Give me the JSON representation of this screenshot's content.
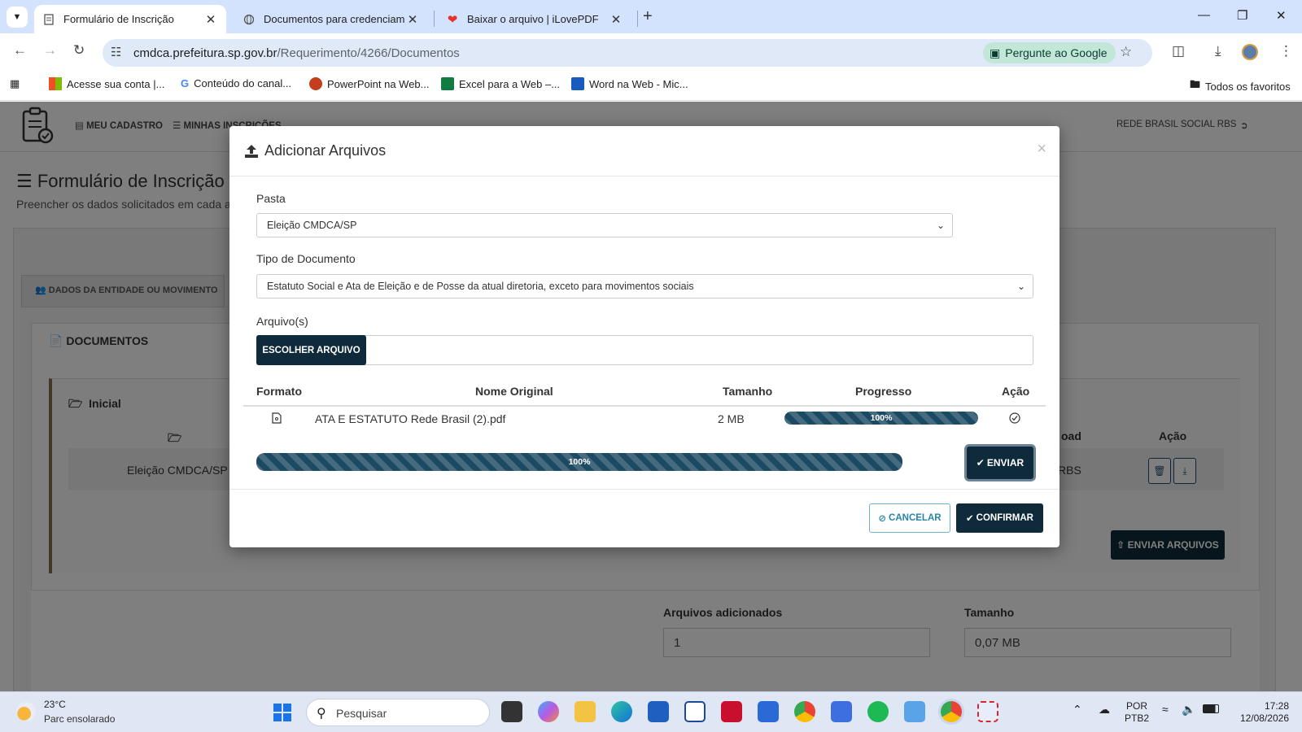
{
  "browser": {
    "tabs": [
      {
        "title": "Formulário de Inscrição",
        "active": true
      },
      {
        "title": "Documentos para credenciamento",
        "active": false
      },
      {
        "title": "Baixar o arquivo | iLovePDF",
        "active": false
      }
    ],
    "url_host": "cmdca.prefeitura.sp.gov.br",
    "url_path": "/Requerimento/4266/Documentos",
    "ask_google": "Pergunte ao Google",
    "bookmarks": [
      "Acesse sua conta |...",
      "Conteúdo do canal...",
      "PowerPoint na Web...",
      "Excel para a Web –...",
      "Word na Web - Mic..."
    ],
    "all_favorites": "Todos os favoritos"
  },
  "page": {
    "nav_cadastro": "MEU CADASTRO",
    "nav_inscricoes": "MINHAS INSCRIÇÕES",
    "user": "REDE BRASIL SOCIAL RBS",
    "title": "Formulário de Inscrição",
    "subtitle": "Preencher os dados solicitados em cada ab",
    "tab_dados": "DADOS DA ENTIDADE OU MOVIMENTO",
    "documentos": "DOCUMENTOS",
    "inicial": "Inicial",
    "row_pasta": "Eleição CMDCA/SP",
    "row_rbs": "RBS",
    "col_upload": "oad",
    "col_acao": "Ação",
    "enviar_arquivos": "ENVIAR ARQUIVOS",
    "arquivos_adicionados_label": "Arquivos adicionados",
    "arquivos_adicionados_value": "1",
    "tamanho_label": "Tamanho",
    "tamanho_value": "0,07 MB"
  },
  "modal": {
    "title": "Adicionar Arquivos",
    "close": "×",
    "pasta_label": "Pasta",
    "pasta_value": "Eleição CMDCA/SP",
    "tipo_label": "Tipo de Documento",
    "tipo_value": "Estatuto Social e Ata de Eleição e de Posse da atual diretoria, exceto para movimentos sociais",
    "arquivos_label": "Arquivo(s)",
    "choose_button": "ESCOLHER ARQUIVO",
    "table_headers": {
      "formato": "Formato",
      "nome": "Nome Original",
      "tamanho": "Tamanho",
      "progresso": "Progresso",
      "acao": "Ação"
    },
    "file": {
      "name": "ATA E ESTATUTO Rede Brasil (2).pdf",
      "size": "2 MB",
      "progress": 100,
      "progress_label": "100%"
    },
    "total_progress": 100,
    "total_progress_label": "100%",
    "enviar": "ENVIAR",
    "cancelar": "CANCELAR",
    "confirmar": "CONFIRMAR"
  },
  "taskbar": {
    "temp": "23°C",
    "weather": "Parc ensolarado",
    "search_placeholder": "Pesquisar",
    "lang": "POR",
    "layout": "PTB2",
    "time": "17:28",
    "date": "12/08/2026"
  },
  "colors": {
    "primary": "#0f2b3b",
    "progress": "#1c4a63",
    "accent_outline": "#2a86a6"
  }
}
